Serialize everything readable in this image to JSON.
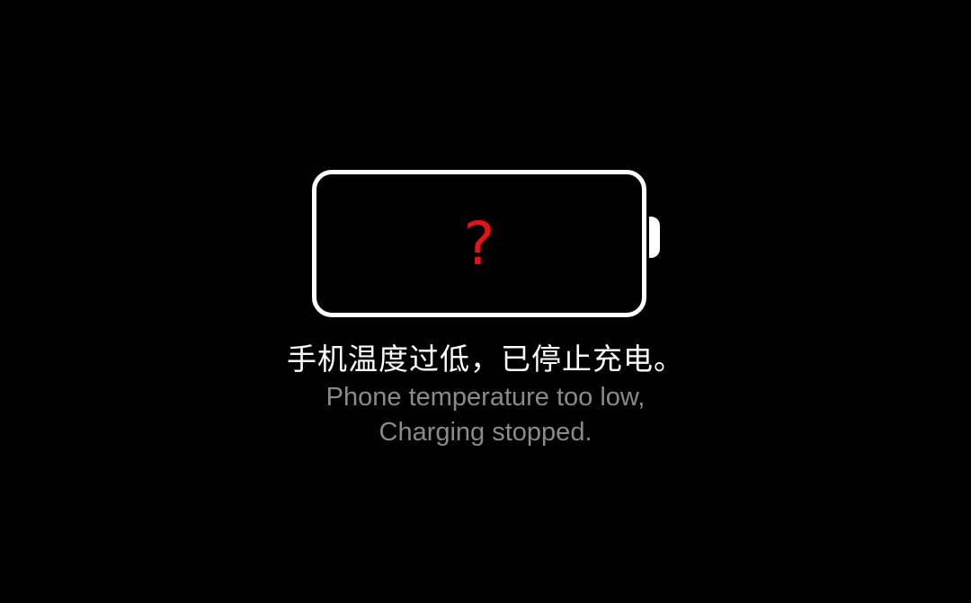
{
  "alert": {
    "icon": "battery-unknown-icon",
    "symbol": "?",
    "symbol_color": "#e5121c",
    "message_cn": "手机温度过低，已停止充电。",
    "message_en_line1": "Phone temperature too low,",
    "message_en_line2": "Charging stopped."
  },
  "colors": {
    "background": "#000000",
    "outline": "#ffffff",
    "secondary_text": "#8a8a8a"
  }
}
